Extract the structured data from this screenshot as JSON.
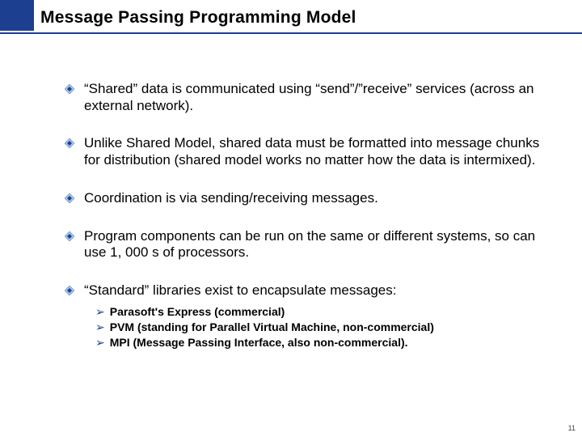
{
  "title": "Message Passing Programming Model",
  "bullets": [
    {
      "text": "“Shared” data is communicated using “send”/”receive” services (across an external network)."
    },
    {
      "text": "Unlike Shared Model, shared data must be formatted into message chunks for distribution (shared model works no matter how the data is intermixed)."
    },
    {
      "text": "Coordination is via sending/receiving messages."
    },
    {
      "text": "Program components can be run on the same or different systems, so can use 1, 000 s of processors."
    },
    {
      "text": "“Standard” libraries exist to encapsulate messages:"
    }
  ],
  "sublist": [
    "Parasoft's Express (commercial)",
    "PVM (standing for Parallel Virtual Machine, non-commercial)",
    "MPI (Message Passing Interface, also non-commercial)."
  ],
  "page_number": "11"
}
